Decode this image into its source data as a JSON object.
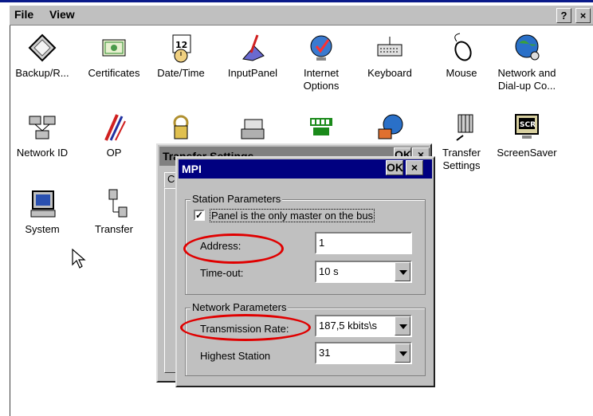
{
  "menubar": {
    "file": "File",
    "view": "View",
    "help": "?",
    "close": "×"
  },
  "icons": [
    {
      "label": "Backup/R...",
      "icon": "backup-icon"
    },
    {
      "label": "Certificates",
      "icon": "certificates-icon"
    },
    {
      "label": "Date/Time",
      "icon": "date-time-icon"
    },
    {
      "label": "InputPanel",
      "icon": "input-panel-icon"
    },
    {
      "label": "Internet Options",
      "icon": "internet-options-icon"
    },
    {
      "label": "Keyboard",
      "icon": "keyboard-icon"
    },
    {
      "label": "Mouse",
      "icon": "mouse-icon"
    },
    {
      "label": "Network and Dial-up Co...",
      "icon": "network-icon"
    },
    {
      "label": "Network ID",
      "icon": "network-id-icon"
    },
    {
      "label": "OP",
      "icon": "op-icon"
    },
    {
      "label": "Transfer Settings",
      "icon": "transfer-settings-icon"
    },
    {
      "label": "ScreenSaver",
      "icon": "screensaver-icon"
    },
    {
      "label": "System",
      "icon": "system-icon"
    },
    {
      "label": "Transfer",
      "icon": "transfer-icon"
    }
  ],
  "transfer_dialog": {
    "title": "Transfer Settings",
    "ok": "OK",
    "close": "×"
  },
  "mpi_dialog": {
    "title": "MPI",
    "ok": "OK",
    "close": "×",
    "station": {
      "group_label": "Station Parameters",
      "checkbox_label": "Panel is the only master on the bus",
      "checkbox_checked": true,
      "address_label": "Address:",
      "address_value": "1",
      "timeout_label": "Time-out:",
      "timeout_value": "10 s"
    },
    "network": {
      "group_label": "Network Parameters",
      "rate_label": "Transmission Rate:",
      "rate_value": "187,5 kbits\\s",
      "highest_label": "Highest Station",
      "highest_value": "31"
    }
  },
  "colors": {
    "titlebar": "#000080",
    "window": "#c0c0c0",
    "highlight": "#e00000"
  }
}
